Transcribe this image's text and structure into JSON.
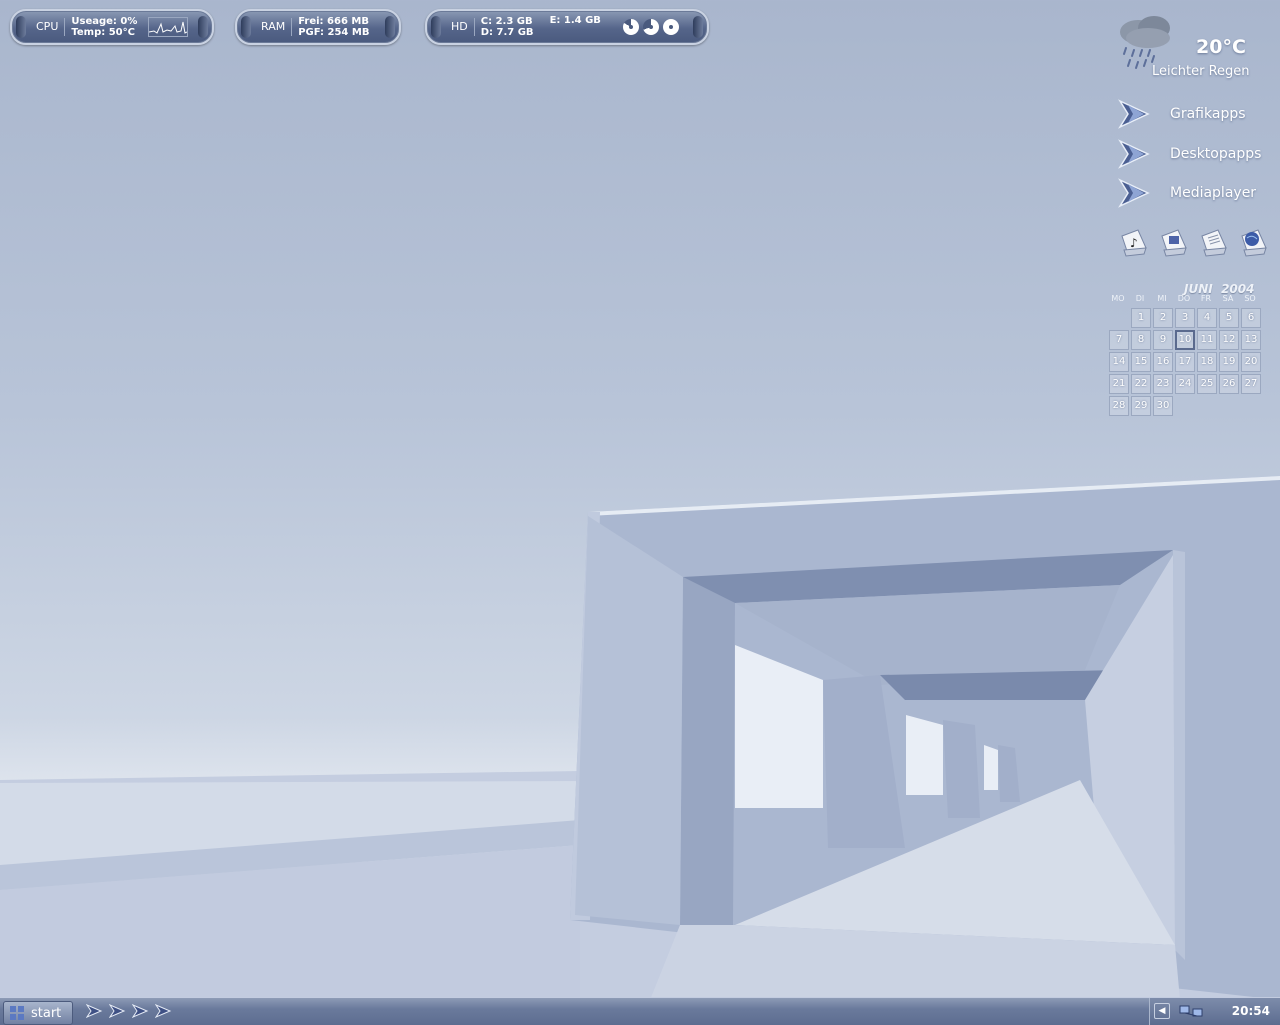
{
  "monitors": {
    "cpu": {
      "label": "CPU",
      "usage": "Useage: 0%",
      "temp": "Temp: 50°C"
    },
    "ram": {
      "label": "RAM",
      "free": "Frei: 666 MB",
      "pgf": "PGF: 254 MB"
    },
    "hd": {
      "label": "HD",
      "c": "C: 2.3 GB",
      "d": "D: 7.7 GB",
      "e": "E: 1.4 GB"
    }
  },
  "weather": {
    "temperature": "20°C",
    "condition": "Leichter Regen",
    "icon": "rain-cloud-icon"
  },
  "launchers": [
    {
      "label": "Grafikapps",
      "icon": "arrow-chevron-icon"
    },
    {
      "label": "Desktopapps",
      "icon": "arrow-chevron-icon"
    },
    {
      "label": "Mediaplayer",
      "icon": "arrow-chevron-icon"
    }
  ],
  "shortcuts": [
    "music-folder-icon",
    "computer-folder-icon",
    "documents-folder-icon",
    "network-folder-icon"
  ],
  "calendar": {
    "month": "JUNI",
    "year": "2004",
    "weekdays": [
      "MO",
      "DI",
      "MI",
      "DO",
      "FR",
      "SA",
      "SO"
    ],
    "days": [
      "1",
      "2",
      "3",
      "4",
      "5",
      "6",
      "7",
      "8",
      "9",
      "10",
      "11",
      "12",
      "13",
      "14",
      "15",
      "16",
      "17",
      "18",
      "19",
      "20",
      "21",
      "22",
      "23",
      "24",
      "25",
      "26",
      "27",
      "28",
      "29",
      "30"
    ],
    "first_weekday_index": 1,
    "today": "10"
  },
  "taskbar": {
    "start_label": "start",
    "quick_launch": [
      "quicklaunch-chevron-icon",
      "quicklaunch-chevron-icon",
      "quicklaunch-chevron-icon",
      "quicklaunch-chevron-icon"
    ],
    "tray_icons": [
      "network-icon",
      "network-icon"
    ],
    "clock": "20:54"
  },
  "colors": {
    "accent": "#5d6d90",
    "wallpaper": "#b8c4d8"
  }
}
